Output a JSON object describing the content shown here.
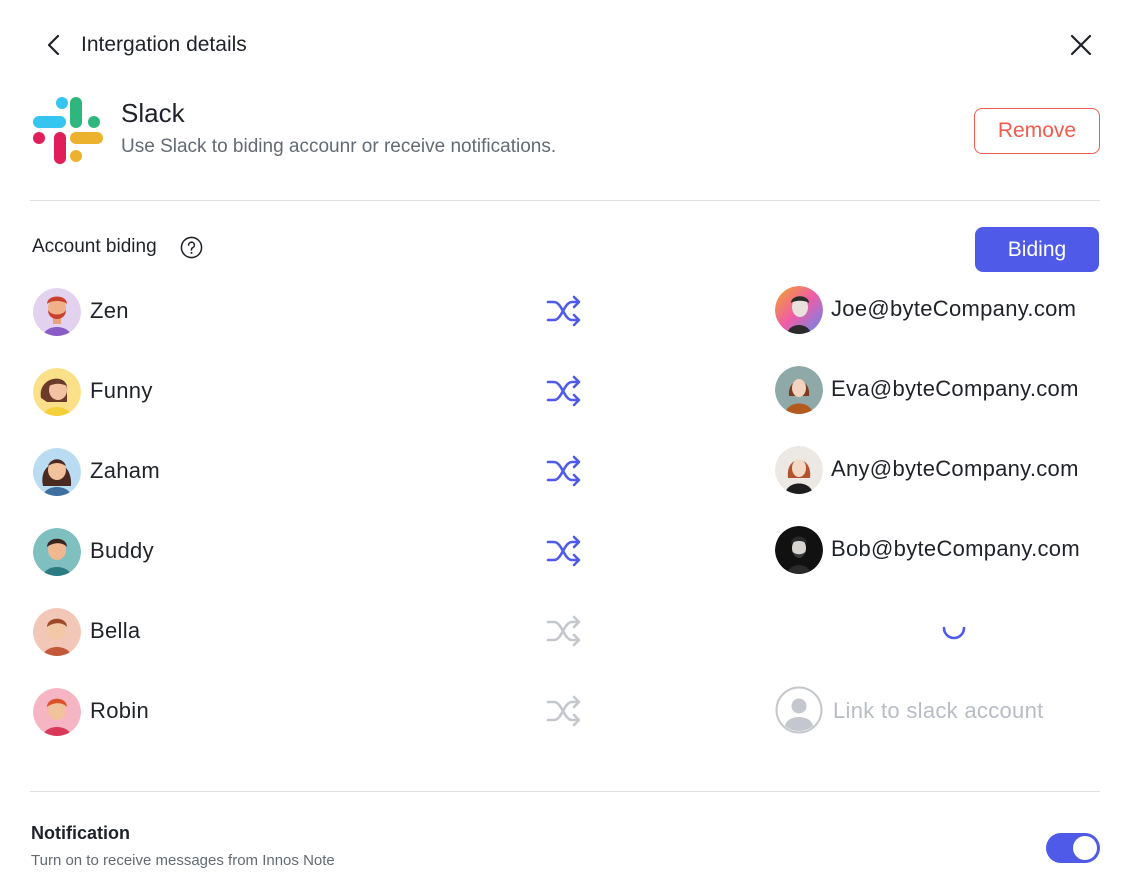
{
  "header": {
    "title": "Intergation details",
    "back_icon": "chevron-left-icon",
    "close_icon": "close-icon"
  },
  "app": {
    "name": "Slack",
    "description": "Use Slack to biding accounr or receive notifications.",
    "logo_icon": "slack-logo",
    "remove_label": "Remove",
    "remove_color": "#f05b4d"
  },
  "account_biding": {
    "title": "Account biding",
    "help_icon": "question-circle-icon",
    "biding_label": "Biding",
    "accent_color": "#4f5be8",
    "rows": [
      {
        "name": "Zen",
        "status": "linked",
        "email": "Joe@byteCompany.com"
      },
      {
        "name": "Funny",
        "status": "linked",
        "email": "Eva@byteCompany.com"
      },
      {
        "name": "Zaham",
        "status": "linked",
        "email": "Any@byteCompany.com"
      },
      {
        "name": "Buddy",
        "status": "linked",
        "email": "Bob@byteCompany.com"
      },
      {
        "name": "Bella",
        "status": "loading"
      },
      {
        "name": "Robin",
        "status": "unlinked",
        "link_text": "Link to slack account"
      }
    ]
  },
  "notification": {
    "title": "Notification",
    "description": "Turn on to receive messages from Innos Note",
    "enabled": true
  }
}
